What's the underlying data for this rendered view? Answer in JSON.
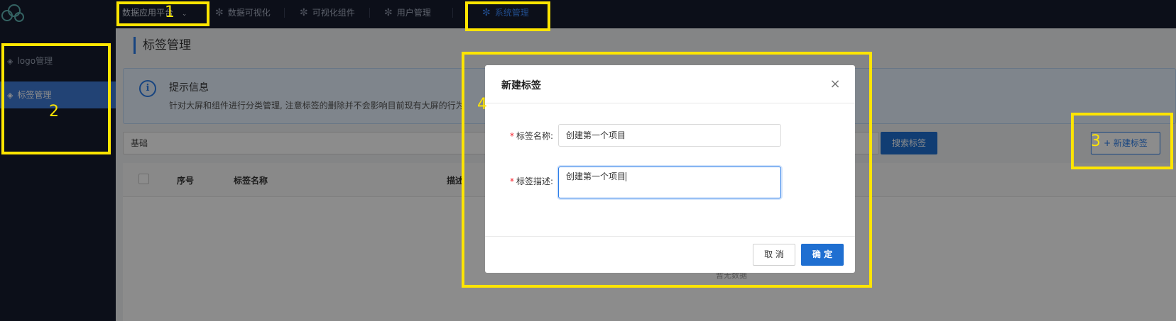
{
  "topnav": {
    "platform_label": "数据应用平台",
    "items": [
      {
        "label": "数据可视化"
      },
      {
        "label": "可视化组件"
      },
      {
        "label": "用户管理"
      },
      {
        "label": "系统管理"
      }
    ]
  },
  "sidebar": {
    "items": [
      {
        "label": "logo管理"
      },
      {
        "label": "标签管理"
      }
    ]
  },
  "page": {
    "title": "标签管理",
    "info_title": "提示信息",
    "info_text": "针对大屏和组件进行分类管理, 注意标签的删除并不会影响目前现有大屏的行为",
    "search_value": "基础",
    "search_button": "搜索标签",
    "create_button": "+ 新建标签",
    "table": {
      "headers": [
        "序号",
        "标签名称",
        "描述"
      ],
      "empty_text": "暂无数据"
    }
  },
  "modal": {
    "title": "新建标签",
    "close_icon": "×",
    "name_label": "标签名称:",
    "name_value": "创建第一个项目",
    "desc_label": "标签描述:",
    "desc_value": "创建第一个项目",
    "cancel_label": "取 消",
    "ok_label": "确 定",
    "required_mark": "*"
  },
  "annotations": [
    "1",
    "2",
    "3",
    "4"
  ],
  "colors": {
    "nav_bg": "#161c2e",
    "accent": "#2b7de9",
    "annotation": "#ffe500"
  }
}
